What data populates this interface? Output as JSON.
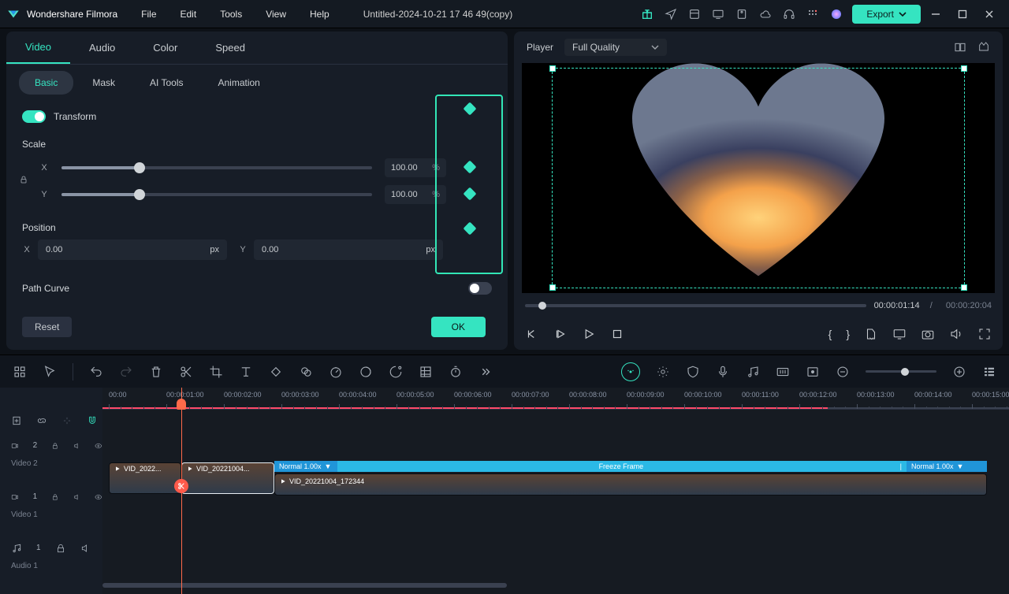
{
  "app": {
    "name": "Wondershare Filmora",
    "title": "Untitled-2024-10-21 17 46 49(copy)"
  },
  "menu": [
    "File",
    "Edit",
    "Tools",
    "View",
    "Help"
  ],
  "export": "Export",
  "tabs1": [
    "Video",
    "Audio",
    "Color",
    "Speed"
  ],
  "tabs2": [
    "Basic",
    "Mask",
    "AI Tools",
    "Animation"
  ],
  "transform": {
    "label": "Transform",
    "scale_label": "Scale",
    "scale_x": "100.00",
    "scale_y": "100.00",
    "scale_unit": "%",
    "x_axis": "X",
    "y_axis": "Y",
    "position_label": "Position",
    "pos_x": "0.00",
    "pos_y": "0.00",
    "px": "px",
    "path_curve": "Path Curve",
    "reset": "Reset",
    "ok": "OK"
  },
  "player": {
    "label": "Player",
    "quality": "Full Quality",
    "time_current": "00:00:01:14",
    "time_total": "00:00:20:04",
    "time_sep": "/"
  },
  "timeline": {
    "ticks": [
      "00:00",
      "00:00:01:00",
      "00:00:02:00",
      "00:00:03:00",
      "00:00:04:00",
      "00:00:05:00",
      "00:00:06:00",
      "00:00:07:00",
      "00:00:08:00",
      "00:00:09:00",
      "00:00:10:00",
      "00:00:11:00",
      "00:00:12:00",
      "00:00:13:00",
      "00:00:14:00",
      "00:00:15:00"
    ],
    "tracks": {
      "v2": "Video 2",
      "v1": "Video 1",
      "a1": "Audio 1",
      "v2_num": "2",
      "v1_num": "1",
      "a1_num": "1"
    },
    "clip1_label": "VID_2022...",
    "clip2_label": "VID_20221004...",
    "clip3_label": "VID_20221004_172344",
    "freeze": "Freeze Frame",
    "normal": "Normal 1.00x"
  }
}
